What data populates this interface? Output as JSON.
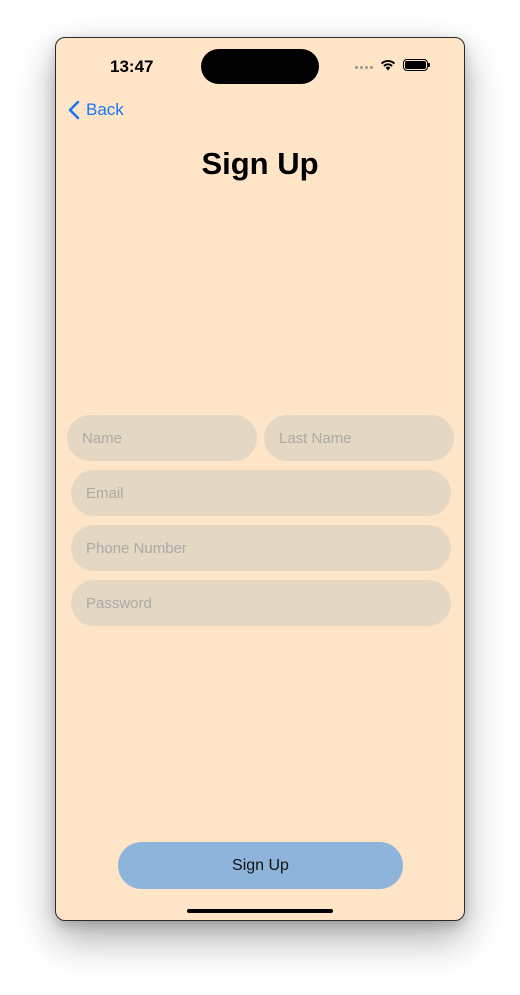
{
  "status_bar": {
    "time": "13:47"
  },
  "nav": {
    "back_label": "Back"
  },
  "page": {
    "title": "Sign Up"
  },
  "form": {
    "name_placeholder": "Name",
    "last_name_placeholder": "Last Name",
    "email_placeholder": "Email",
    "phone_placeholder": "Phone Number",
    "password_placeholder": "Password"
  },
  "actions": {
    "signup_label": "Sign Up"
  },
  "colors": {
    "background": "#ffe5c8",
    "field_background": "#e4d8c5",
    "accent": "#1477f5",
    "button_background": "#8fb4dc"
  },
  "icons": {
    "back": "chevron-left-icon",
    "wifi": "wifi-icon",
    "battery": "battery-icon",
    "signal": "signal-icon"
  }
}
